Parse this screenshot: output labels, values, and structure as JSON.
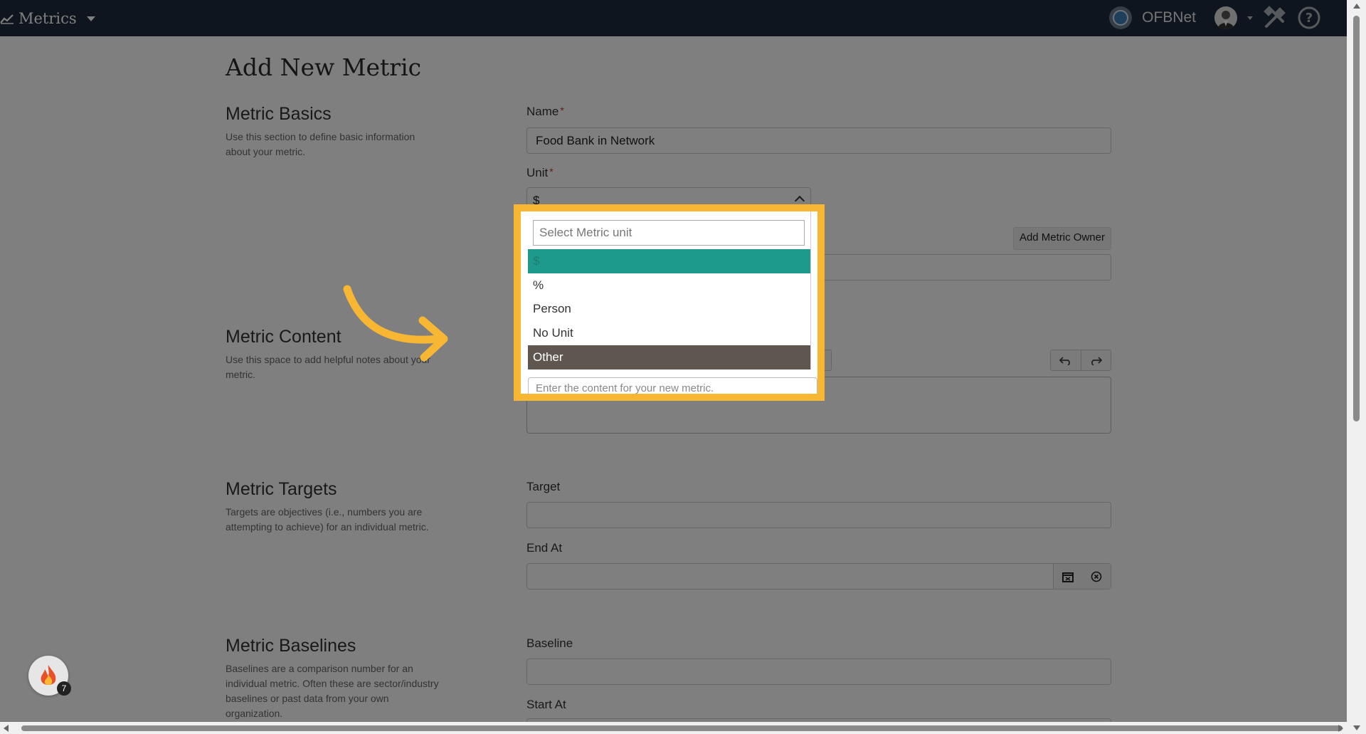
{
  "topbar": {
    "nav_label": "Metrics",
    "org_name": "OFBNet"
  },
  "page": {
    "title": "Add New Metric"
  },
  "sections": {
    "basics": {
      "title": "Metric Basics",
      "desc": "Use this section to define basic information about your metric."
    },
    "content": {
      "title": "Metric Content",
      "desc": "Use this space to add helpful notes about your metric."
    },
    "targets": {
      "title": "Metric Targets",
      "desc": "Targets are objectives (i.e., numbers you are attempting to achieve) for an individual metric."
    },
    "baselines": {
      "title": "Metric Baselines",
      "desc": "Baselines are a comparison number for an individual metric. Often these are sector/industry baselines or past data from your own organization."
    }
  },
  "fields": {
    "name_label": "Name",
    "name_value": "Food Bank in Network",
    "required_mark": "*",
    "unit_label": "Unit",
    "unit_value": "$",
    "add_owner_label": "Add Metric Owner",
    "target_label": "Target",
    "end_at_label": "End At",
    "baseline_label": "Baseline",
    "start_at_label": "Start At"
  },
  "dropdown": {
    "search_placeholder": "Select Metric unit",
    "options": [
      "$",
      "%",
      "Person",
      "No Unit",
      "Other"
    ],
    "selected": "$",
    "hovered": "Other",
    "content_placeholder": "Enter the content for your new metric."
  },
  "badge": {
    "count": "7"
  },
  "colors": {
    "topbar": "#1e2b3c",
    "selected_option": "#1e9a8c",
    "hover_option": "#5f574f",
    "highlight": "#f7b733"
  }
}
